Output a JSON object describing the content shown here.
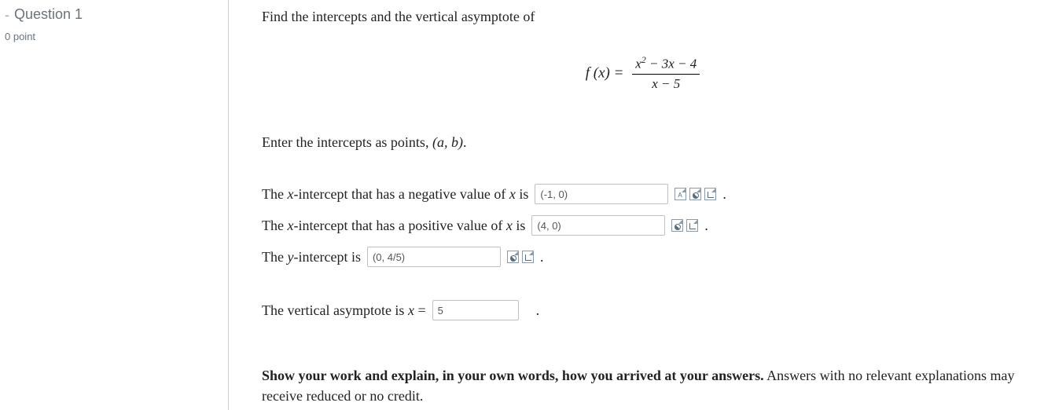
{
  "sidebar": {
    "dash": "-",
    "title": "Question 1",
    "points": "0 point"
  },
  "main": {
    "prompt": "Find the intercepts and the vertical asymptote of",
    "eq_lhs": "f (x) =",
    "eq_num_a": "x",
    "eq_num_exp": "2",
    "eq_num_b": " − 3x − 4",
    "eq_den": "x − 5",
    "instr_a": "Enter the intercepts as points, ",
    "instr_b": "(a, b)",
    "instr_c": ".",
    "line1_a": "The ",
    "line1_var": "x",
    "line1_b": "-intercept that has a negative value of ",
    "line1_var2": "x",
    "line1_c": " is",
    "input1": "(-1, 0)",
    "line2_a": "The ",
    "line2_var": "x",
    "line2_b": "-intercept that has a positive value of ",
    "line2_var2": "x",
    "line2_c": " is",
    "input2": "(4, 0)",
    "line3_a": "The ",
    "line3_var": "y",
    "line3_b": "-intercept is",
    "input3": "(0, 4/5)",
    "line4_a": "The vertical asymptote is ",
    "line4_var": "x",
    "line4_eq": " =",
    "input4": "5",
    "footer_bold": "Show your work and explain, in your own words, how you arrived at your answers.",
    "footer_rest": " Answers with no relevant explanations may receive reduced or no credit.",
    "period": "."
  }
}
